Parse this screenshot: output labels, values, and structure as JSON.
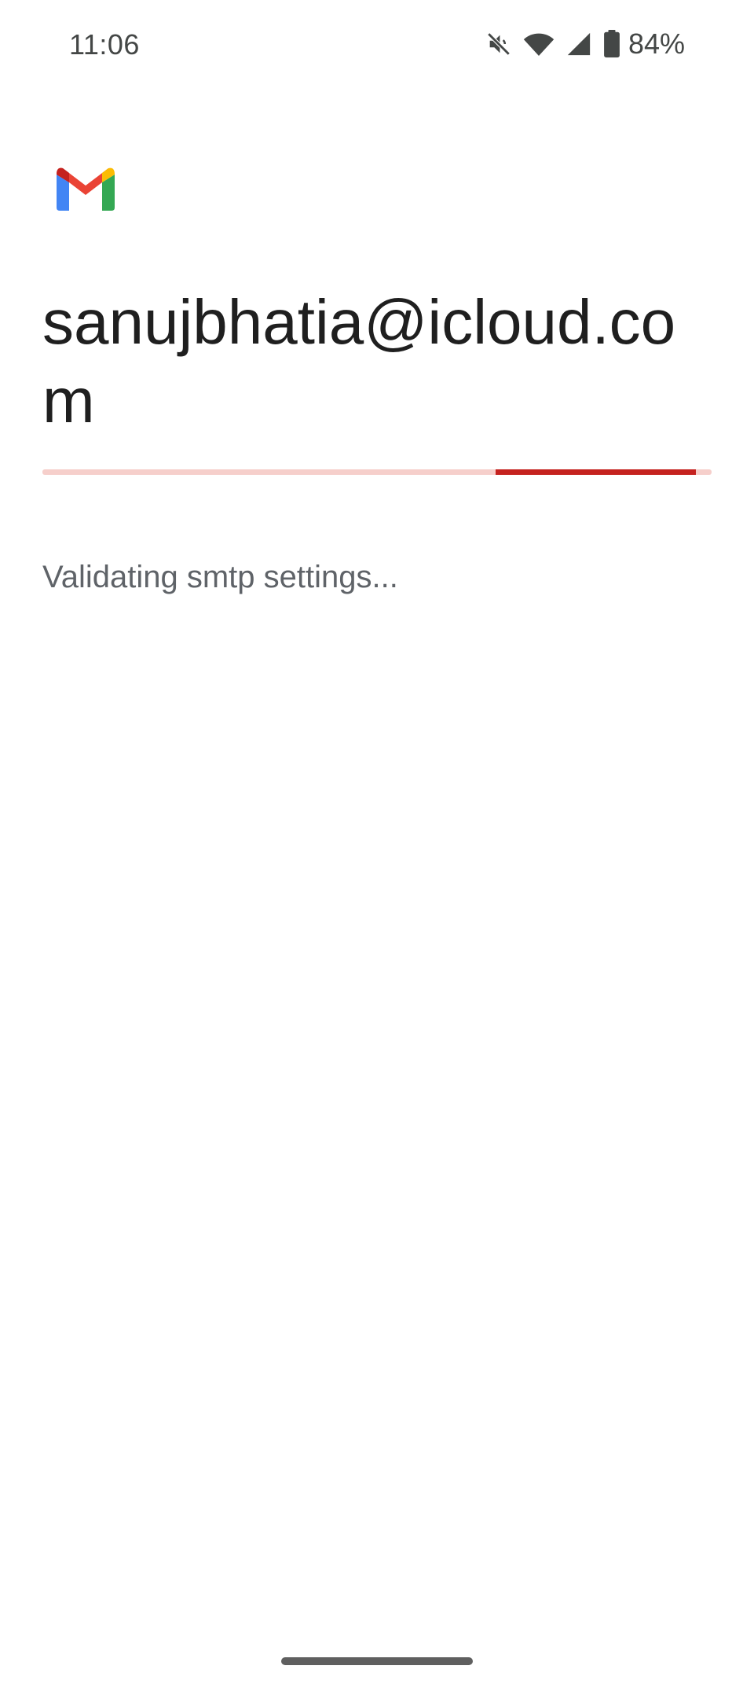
{
  "status_bar": {
    "time": "11:06",
    "battery_percent": "84%",
    "icons": [
      "mute-icon",
      "wifi-icon",
      "signal-icon",
      "battery-icon"
    ]
  },
  "app": {
    "logo": "gmail-logo-icon",
    "colors": {
      "red": "#EA4335",
      "dark_red": "#C5221F",
      "blue": "#4285F4",
      "green": "#34A853",
      "yellow": "#FBBC04"
    }
  },
  "account": {
    "email": "sanujbhatia@icloud.com"
  },
  "progress": {
    "indeterminate": true,
    "segment_start_fraction": 0.677,
    "segment_end_fraction": 0.977,
    "track_color": "#F6CFCB",
    "indicator_color": "#C5221F"
  },
  "status": {
    "message": "Validating smtp settings..."
  }
}
